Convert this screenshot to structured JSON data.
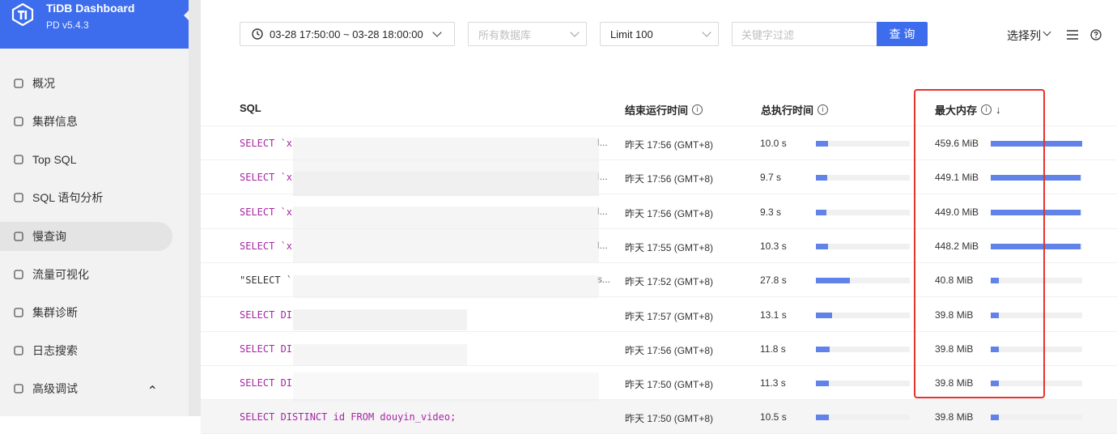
{
  "brand": {
    "title": "TiDB Dashboard",
    "version": "PD v5.4.3"
  },
  "nav": [
    {
      "label": "概况",
      "icon": "grid-icon",
      "active": false
    },
    {
      "label": "集群信息",
      "icon": "cluster-icon",
      "active": false
    },
    {
      "label": "Top SQL",
      "icon": "bar-chart-icon",
      "active": false
    },
    {
      "label": "SQL 语句分析",
      "icon": "lightning-icon",
      "active": false
    },
    {
      "label": "慢查询",
      "icon": "rocket-icon",
      "active": true
    },
    {
      "label": "流量可视化",
      "icon": "eye-icon",
      "active": false
    },
    {
      "label": "集群诊断",
      "icon": "file-icon",
      "active": false
    },
    {
      "label": "日志搜索",
      "icon": "log-search-icon",
      "active": false
    },
    {
      "label": "高级调试",
      "icon": "bug-icon",
      "active": false
    }
  ],
  "toolbar": {
    "time_range": "03-28 17:50:00 ~ 03-28 18:00:00",
    "db_placeholder": "所有数据库",
    "limit": "Limit 100",
    "keyword_placeholder": "关键字过滤",
    "query_label": "查 询",
    "columns_label": "选择列"
  },
  "table": {
    "headers": {
      "sql": "SQL",
      "end_time": "结束运行时间",
      "total_time": "总执行时间",
      "max_mem": "最大内存"
    },
    "rows": [
      {
        "sql": "SELECT `x",
        "kind": "kw",
        "end": "昨天 17:56 (GMT+8)",
        "time": "10.0 s",
        "time_frac": 0.13,
        "mem": "459.6 MiB",
        "mem_frac": 1.0
      },
      {
        "sql": "SELECT `x",
        "kind": "kw",
        "end": "昨天 17:56 (GMT+8)",
        "time": "9.7 s",
        "time_frac": 0.12,
        "mem": "449.1 MiB",
        "mem_frac": 0.98
      },
      {
        "sql": "SELECT `x",
        "kind": "kw",
        "end": "昨天 17:56 (GMT+8)",
        "time": "9.3 s",
        "time_frac": 0.11,
        "mem": "449.0 MiB",
        "mem_frac": 0.98
      },
      {
        "sql": "SELECT `x",
        "kind": "kw",
        "end": "昨天 17:55 (GMT+8)",
        "time": "10.3 s",
        "time_frac": 0.13,
        "mem": "448.2 MiB",
        "mem_frac": 0.98
      },
      {
        "sql": "\"SELECT `",
        "kind": "str",
        "end": "昨天 17:52 (GMT+8)",
        "time": "27.8 s",
        "time_frac": 0.36,
        "mem": "40.8 MiB",
        "mem_frac": 0.09
      },
      {
        "sql": "SELECT DI",
        "kind": "kw",
        "end": "昨天 17:57 (GMT+8)",
        "time": "13.1 s",
        "time_frac": 0.17,
        "mem": "39.8 MiB",
        "mem_frac": 0.09
      },
      {
        "sql": "SELECT DI",
        "kind": "kw",
        "end": "昨天 17:56 (GMT+8)",
        "time": "11.8 s",
        "time_frac": 0.15,
        "mem": "39.8 MiB",
        "mem_frac": 0.09
      },
      {
        "sql": "SELECT DI",
        "kind": "kw",
        "end": "昨天 17:50 (GMT+8)",
        "time": "11.3 s",
        "time_frac": 0.14,
        "mem": "39.8 MiB",
        "mem_frac": 0.09
      },
      {
        "sql": "SELECT DISTINCT id FROM douyin_video;",
        "kind": "kw",
        "end": "昨天 17:50 (GMT+8)",
        "time": "10.5 s",
        "time_frac": 0.14,
        "mem": "39.8 MiB",
        "mem_frac": 0.09
      }
    ]
  }
}
